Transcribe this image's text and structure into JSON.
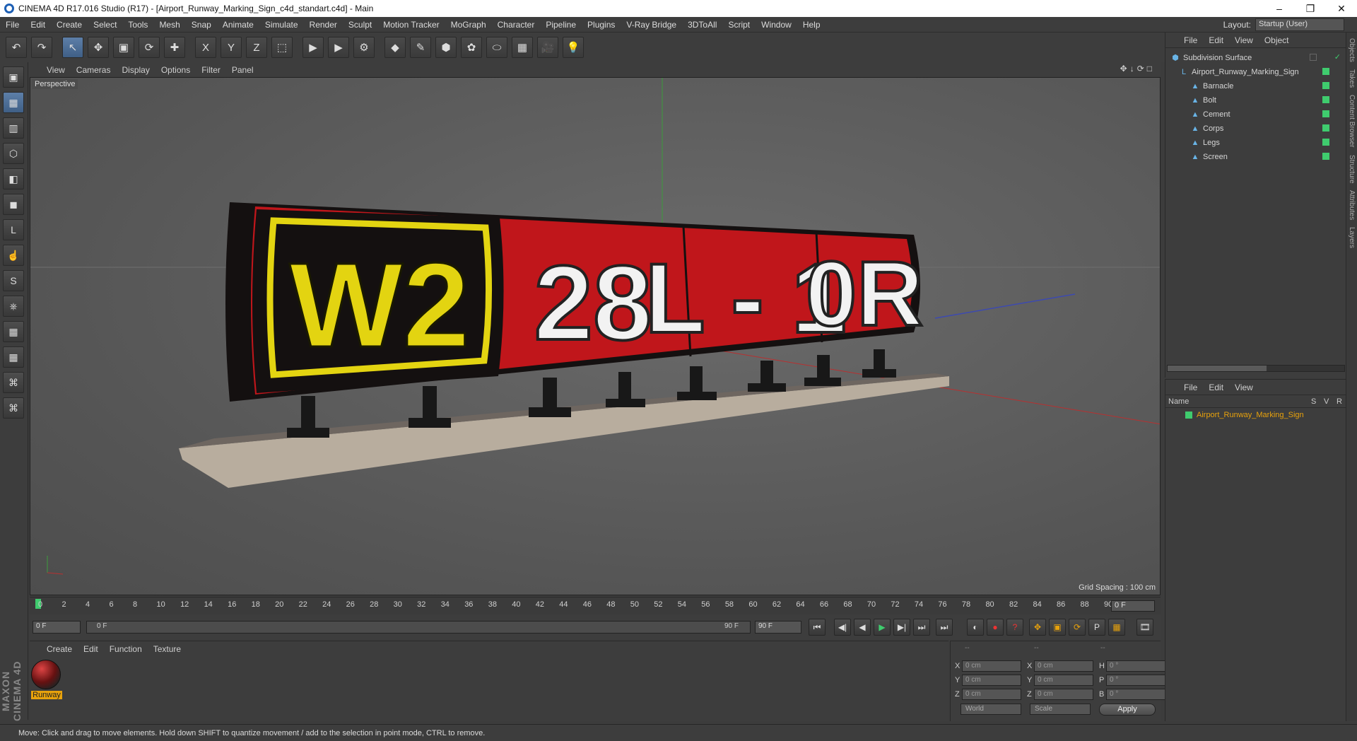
{
  "window": {
    "title": "CINEMA 4D R17.016 Studio (R17) - [Airport_Runway_Marking_Sign_c4d_standart.c4d] - Main",
    "minimize": "–",
    "maximize": "❐",
    "close": "✕"
  },
  "menubar": {
    "items": [
      "File",
      "Edit",
      "Create",
      "Select",
      "Tools",
      "Mesh",
      "Snap",
      "Animate",
      "Simulate",
      "Render",
      "Sculpt",
      "Motion Tracker",
      "MoGraph",
      "Character",
      "Pipeline",
      "Plugins",
      "V-Ray Bridge",
      "3DToAll",
      "Script",
      "Window",
      "Help"
    ],
    "layout_label": "Layout:",
    "layout_value": "Startup (User)"
  },
  "toolbar": {
    "undo": "↶",
    "redo": "↷",
    "select": "↖",
    "move": "✥",
    "scale": "▣",
    "rotate": "⟳",
    "last": "✚",
    "x": "X",
    "y": "Y",
    "z": "Z",
    "coord": "⬚",
    "render_view": "▶",
    "render_picture": "▶",
    "render_settings": "⚙",
    "cube": "◆",
    "pen": "✎",
    "subdiv": "⬢",
    "gen": "✿",
    "deform": "⬭",
    "floor": "▦",
    "camera": "🎥",
    "light": "💡"
  },
  "lefttools": [
    "▣",
    "▦",
    "▥",
    "⬡",
    "◧",
    "◼",
    "L",
    "☝",
    "S",
    "⎈",
    "▦",
    "▦",
    "⌘",
    "⌘"
  ],
  "brand": "MAXON CINEMA 4D",
  "viewport": {
    "menu": [
      "View",
      "Cameras",
      "Display",
      "Options",
      "Filter",
      "Panel"
    ],
    "icons": "✥↓⟳□",
    "label": "Perspective",
    "grid_spacing": "Grid Spacing : 100 cm",
    "sign": {
      "panel1": "W2",
      "panel2": "28",
      "panel3": "L - 1",
      "panel4": "0R"
    },
    "colors": {
      "sign_black": "#141010",
      "sign_red": "#c0161b",
      "sign_yellow": "#e3d411",
      "sign_white": "#f2f2f2",
      "base": "#b8ad9e"
    }
  },
  "timeline": {
    "ticks": [
      "0",
      "2",
      "4",
      "6",
      "8",
      "10",
      "12",
      "14",
      "16",
      "18",
      "20",
      "22",
      "24",
      "26",
      "28",
      "30",
      "32",
      "34",
      "36",
      "38",
      "40",
      "42",
      "44",
      "46",
      "48",
      "50",
      "52",
      "54",
      "56",
      "58",
      "60",
      "62",
      "64",
      "66",
      "68",
      "70",
      "72",
      "74",
      "76",
      "78",
      "80",
      "82",
      "84",
      "86",
      "88",
      "90"
    ],
    "end_frame": "0 F"
  },
  "transport": {
    "start": "0 F",
    "slider_start": "0 F",
    "slider_end": "90 F",
    "end": "90 F",
    "buttons": [
      "⏮",
      "◀|",
      "◀",
      "▶",
      "▶|",
      "⏭",
      "⏭"
    ],
    "rec": [
      "◐",
      "●",
      "?",
      "✥",
      "▣",
      "⟳",
      "P",
      "▦",
      "🎞"
    ]
  },
  "material_panel": {
    "menu": [
      "Create",
      "Edit",
      "Function",
      "Texture"
    ],
    "material_name": "Runway"
  },
  "coords": {
    "headers": [
      "--",
      "--",
      "--"
    ],
    "rows": [
      {
        "l1": "X",
        "v1": "0 cm",
        "l2": "X",
        "v2": "0 cm",
        "l3": "H",
        "v3": "0 °"
      },
      {
        "l1": "Y",
        "v1": "0 cm",
        "l2": "Y",
        "v2": "0 cm",
        "l3": "P",
        "v3": "0 °"
      },
      {
        "l1": "Z",
        "v1": "0 cm",
        "l2": "Z",
        "v2": "0 cm",
        "l3": "B",
        "v3": "0 °"
      }
    ],
    "world": "World",
    "scale": "Scale",
    "apply": "Apply"
  },
  "object_manager": {
    "menu": [
      "File",
      "Edit",
      "View",
      "Object"
    ],
    "items": [
      {
        "name": "Subdivision Surface",
        "indent": 0
      },
      {
        "name": "Airport_Runway_Marking_Sign",
        "indent": 1
      },
      {
        "name": "Barnacle",
        "indent": 2
      },
      {
        "name": "Bolt",
        "indent": 2
      },
      {
        "name": "Cement",
        "indent": 2
      },
      {
        "name": "Corps",
        "indent": 2
      },
      {
        "name": "Legs",
        "indent": 2
      },
      {
        "name": "Screen",
        "indent": 2
      }
    ]
  },
  "layer_manager": {
    "menu": [
      "File",
      "Edit",
      "View"
    ],
    "headers": {
      "name": "Name",
      "s": "S",
      "v": "V",
      "r": "R"
    },
    "layer": "Airport_Runway_Marking_Sign"
  },
  "right_tabs": [
    "Objects",
    "Takes",
    "Content Browser",
    "Structure",
    "Attributes",
    "Layers"
  ],
  "status": "Move: Click and drag to move elements. Hold down SHIFT to quantize movement / add to the selection in point mode, CTRL to remove."
}
